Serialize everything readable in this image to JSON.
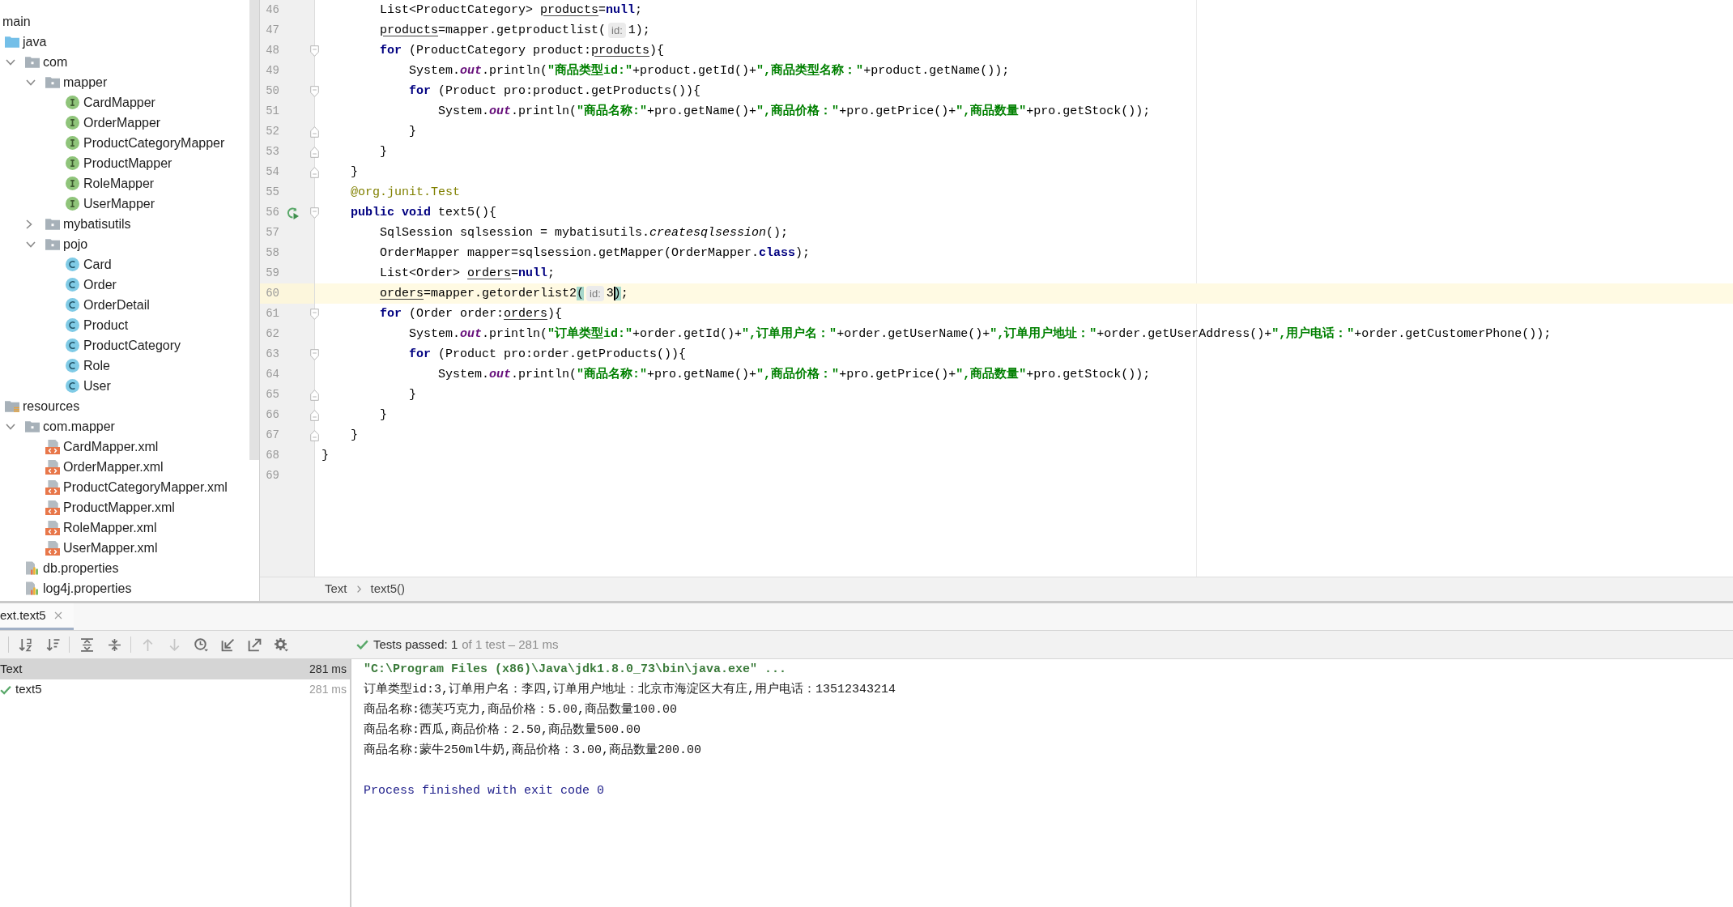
{
  "project_tree": {
    "items": [
      {
        "label": "main",
        "children": [
          {
            "label": "java",
            "kind": "source_folder",
            "children": [
              {
                "label": "com",
                "kind": "package",
                "expanded": true,
                "children": [
                  {
                    "label": "mapper",
                    "kind": "package",
                    "expanded": true,
                    "children": [
                      {
                        "label": "CardMapper",
                        "kind": "interface"
                      },
                      {
                        "label": "OrderMapper",
                        "kind": "interface"
                      },
                      {
                        "label": "ProductCategoryMapper",
                        "kind": "interface"
                      },
                      {
                        "label": "ProductMapper",
                        "kind": "interface"
                      },
                      {
                        "label": "RoleMapper",
                        "kind": "interface"
                      },
                      {
                        "label": "UserMapper",
                        "kind": "interface"
                      }
                    ]
                  },
                  {
                    "label": "mybatisutils",
                    "kind": "package",
                    "expanded": false
                  },
                  {
                    "label": "pojo",
                    "kind": "package",
                    "expanded": true,
                    "children": [
                      {
                        "label": "Card",
                        "kind": "class"
                      },
                      {
                        "label": "Order",
                        "kind": "class"
                      },
                      {
                        "label": "OrderDetail",
                        "kind": "class"
                      },
                      {
                        "label": "Product",
                        "kind": "class"
                      },
                      {
                        "label": "ProductCategory",
                        "kind": "class"
                      },
                      {
                        "label": "Role",
                        "kind": "class"
                      },
                      {
                        "label": "User",
                        "kind": "class"
                      }
                    ]
                  }
                ]
              }
            ]
          },
          {
            "label": "resources",
            "kind": "resources_folder",
            "children": [
              {
                "label": "com.mapper",
                "kind": "package",
                "expanded": true,
                "children": [
                  {
                    "label": "CardMapper.xml",
                    "kind": "xml"
                  },
                  {
                    "label": "OrderMapper.xml",
                    "kind": "xml"
                  },
                  {
                    "label": "ProductCategoryMapper.xml",
                    "kind": "xml"
                  },
                  {
                    "label": "ProductMapper.xml",
                    "kind": "xml"
                  },
                  {
                    "label": "RoleMapper.xml",
                    "kind": "xml"
                  },
                  {
                    "label": "UserMapper.xml",
                    "kind": "xml"
                  }
                ]
              },
              {
                "label": "db.properties",
                "kind": "properties"
              },
              {
                "label": "log4j.properties",
                "kind": "properties"
              }
            ]
          }
        ]
      }
    ]
  },
  "editor": {
    "lines": [
      {
        "number": "46",
        "current": false,
        "run": false,
        "tokens": [
          {
            "kind": "plain",
            "text": "        List<ProductCategory> "
          },
          {
            "kind": "local",
            "text": "products"
          },
          {
            "kind": "plain",
            "text": "="
          },
          {
            "kind": "keyword",
            "text": "null"
          },
          {
            "kind": "plain",
            "text": ";"
          }
        ]
      },
      {
        "number": "47",
        "current": false,
        "run": false,
        "tokens": [
          {
            "kind": "local",
            "text": "        products"
          },
          {
            "kind": "plain",
            "text": "=mapper.getproductlist("
          },
          {
            "kind": "hint",
            "text": "id:"
          },
          {
            "kind": "plain",
            "text": "1);"
          }
        ]
      },
      {
        "number": "48",
        "current": false,
        "run": false,
        "fold": {
          "kind": "start"
        },
        "tokens": [
          {
            "kind": "keyword",
            "text": "        for"
          },
          {
            "kind": "plain",
            "text": " (ProductCategory product:"
          },
          {
            "kind": "local",
            "text": "products"
          },
          {
            "kind": "plain",
            "text": "){"
          }
        ]
      },
      {
        "number": "49",
        "current": false,
        "run": false,
        "tokens": [
          {
            "kind": "plain",
            "text": "            System."
          },
          {
            "kind": "field",
            "text": "out"
          },
          {
            "kind": "plain",
            "text": ".println("
          },
          {
            "kind": "string",
            "text": "\"商品类型id:\""
          },
          {
            "kind": "plain",
            "text": "+product.getId()+"
          },
          {
            "kind": "string",
            "text": "\",商品类型名称：\""
          },
          {
            "kind": "plain",
            "text": "+product.getName());"
          }
        ]
      },
      {
        "number": "50",
        "current": false,
        "run": false,
        "fold": {
          "kind": "start"
        },
        "tokens": [
          {
            "kind": "keyword",
            "text": "            for"
          },
          {
            "kind": "plain",
            "text": " (Product pro:product.getProducts()){"
          }
        ]
      },
      {
        "number": "51",
        "current": false,
        "run": false,
        "tokens": [
          {
            "kind": "plain",
            "text": "                System."
          },
          {
            "kind": "field",
            "text": "out"
          },
          {
            "kind": "plain",
            "text": ".println("
          },
          {
            "kind": "string",
            "text": "\"商品名称:\""
          },
          {
            "kind": "plain",
            "text": "+pro.getName()+"
          },
          {
            "kind": "string",
            "text": "\",商品价格：\""
          },
          {
            "kind": "plain",
            "text": "+pro.getPrice()+"
          },
          {
            "kind": "string",
            "text": "\",商品数量\""
          },
          {
            "kind": "plain",
            "text": "+pro.getStock());"
          }
        ]
      },
      {
        "number": "52",
        "current": false,
        "run": false,
        "fold": {
          "kind": "end"
        },
        "tokens": [
          {
            "kind": "plain",
            "text": "            }"
          }
        ]
      },
      {
        "number": "53",
        "current": false,
        "run": false,
        "fold": {
          "kind": "end"
        },
        "tokens": [
          {
            "kind": "plain",
            "text": "        }"
          }
        ]
      },
      {
        "number": "54",
        "current": false,
        "run": false,
        "fold": {
          "kind": "end"
        },
        "tokens": [
          {
            "kind": "plain",
            "text": "    }"
          }
        ]
      },
      {
        "number": "55",
        "current": false,
        "run": false,
        "tokens": [
          {
            "kind": "annotation",
            "text": "    @org.junit.Test"
          }
        ]
      },
      {
        "number": "56",
        "current": false,
        "run": true,
        "fold": {
          "kind": "start"
        },
        "tokens": [
          {
            "kind": "keyword",
            "text": "    public void"
          },
          {
            "kind": "plain",
            "text": " text5(){"
          }
        ]
      },
      {
        "number": "57",
        "current": false,
        "run": false,
        "tokens": [
          {
            "kind": "plain",
            "text": "        SqlSession sqlsession = mybatisutils."
          },
          {
            "kind": "static",
            "text": "createsqlsession"
          },
          {
            "kind": "plain",
            "text": "();"
          }
        ]
      },
      {
        "number": "58",
        "current": false,
        "run": false,
        "tokens": [
          {
            "kind": "plain",
            "text": "        OrderMapper mapper=sqlsession.getMapper(OrderMapper."
          },
          {
            "kind": "keyword",
            "text": "class"
          },
          {
            "kind": "plain",
            "text": ");"
          }
        ]
      },
      {
        "number": "59",
        "current": false,
        "run": false,
        "tokens": [
          {
            "kind": "plain",
            "text": "        List<Order> "
          },
          {
            "kind": "local",
            "text": "orders"
          },
          {
            "kind": "plain",
            "text": "="
          },
          {
            "kind": "keyword",
            "text": "null"
          },
          {
            "kind": "plain",
            "text": ";"
          }
        ]
      },
      {
        "number": "60",
        "current": true,
        "run": false,
        "tokens": [
          {
            "kind": "local",
            "text": "        orders"
          },
          {
            "kind": "plain",
            "text": "=mapper.getorderlist2"
          },
          {
            "kind": "match",
            "text": "(",
            "caret": false
          },
          {
            "kind": "hint",
            "text": "id:"
          },
          {
            "kind": "plain",
            "text": "3"
          },
          {
            "kind": "match",
            "text": ")",
            "caret": true
          },
          {
            "kind": "plain",
            "text": ";"
          }
        ]
      },
      {
        "number": "61",
        "current": false,
        "run": false,
        "fold": {
          "kind": "start"
        },
        "tokens": [
          {
            "kind": "keyword",
            "text": "        for"
          },
          {
            "kind": "plain",
            "text": " (Order order:"
          },
          {
            "kind": "local",
            "text": "orders"
          },
          {
            "kind": "plain",
            "text": "){"
          }
        ]
      },
      {
        "number": "62",
        "current": false,
        "run": false,
        "tokens": [
          {
            "kind": "plain",
            "text": "            System."
          },
          {
            "kind": "field",
            "text": "out"
          },
          {
            "kind": "plain",
            "text": ".println("
          },
          {
            "kind": "string",
            "text": "\"订单类型id:\""
          },
          {
            "kind": "plain",
            "text": "+order.getId()+"
          },
          {
            "kind": "string",
            "text": "\",订单用户名：\""
          },
          {
            "kind": "plain",
            "text": "+order.getUserName()+"
          },
          {
            "kind": "string",
            "text": "\",订单用户地址：\""
          },
          {
            "kind": "plain",
            "text": "+order.getUserAddress()+"
          },
          {
            "kind": "string",
            "text": "\",用户电话：\""
          },
          {
            "kind": "plain",
            "text": "+order.getCustomerPhone());"
          }
        ]
      },
      {
        "number": "63",
        "current": false,
        "run": false,
        "fold": {
          "kind": "start"
        },
        "tokens": [
          {
            "kind": "keyword",
            "text": "            for"
          },
          {
            "kind": "plain",
            "text": " (Product pro:order.getProducts()){"
          }
        ]
      },
      {
        "number": "64",
        "current": false,
        "run": false,
        "tokens": [
          {
            "kind": "plain",
            "text": "                System."
          },
          {
            "kind": "field",
            "text": "out"
          },
          {
            "kind": "plain",
            "text": ".println("
          },
          {
            "kind": "string",
            "text": "\"商品名称:\""
          },
          {
            "kind": "plain",
            "text": "+pro.getName()+"
          },
          {
            "kind": "string",
            "text": "\",商品价格：\""
          },
          {
            "kind": "plain",
            "text": "+pro.getPrice()+"
          },
          {
            "kind": "string",
            "text": "\",商品数量\""
          },
          {
            "kind": "plain",
            "text": "+pro.getStock());"
          }
        ]
      },
      {
        "number": "65",
        "current": false,
        "run": false,
        "fold": {
          "kind": "end"
        },
        "tokens": [
          {
            "kind": "plain",
            "text": "            }"
          }
        ]
      },
      {
        "number": "66",
        "current": false,
        "run": false,
        "fold": {
          "kind": "end"
        },
        "tokens": [
          {
            "kind": "plain",
            "text": "        }"
          }
        ]
      },
      {
        "number": "67",
        "current": false,
        "run": false,
        "fold": {
          "kind": "end"
        },
        "tokens": [
          {
            "kind": "plain",
            "text": "    }"
          }
        ]
      },
      {
        "number": "68",
        "current": false,
        "run": false,
        "tokens": [
          {
            "kind": "plain",
            "text": "}"
          }
        ]
      },
      {
        "number": "69",
        "current": false,
        "run": false
      }
    ],
    "breadcrumbs": [
      "Text",
      "text5()"
    ]
  },
  "run_panel": {
    "tabs": [
      {
        "label": "ext.text5",
        "selected": true
      }
    ],
    "toolbar": [
      [
        {
          "disabled": false
        },
        {
          "disabled": false
        }
      ],
      [
        {
          "disabled": false
        },
        {
          "disabled": false
        }
      ],
      [
        {
          "disabled": true
        },
        {
          "disabled": true
        },
        {
          "disabled": false
        },
        {
          "disabled": false
        },
        {
          "disabled": false
        },
        {
          "disabled": false
        }
      ]
    ],
    "status": {
      "passed": true,
      "summary": "Tests passed: 1",
      "detail": "of 1 test – 281 ms"
    },
    "tests": [
      {
        "label": "Text",
        "duration": "281 ms",
        "selected": true,
        "children": [
          {
            "label": "text5",
            "passed": true,
            "duration": "281 ms",
            "selected": false
          }
        ]
      }
    ],
    "console": [
      {
        "kind": "command",
        "text": "\"C:\\Program Files (x86)\\Java\\jdk1.8.0_73\\bin\\java.exe\" ..."
      },
      {
        "kind": "output",
        "text": "订单类型id:3,订单用户名：李四,订单用户地址：北京市海淀区大有庄,用户电话：13512343214"
      },
      {
        "kind": "output",
        "text": "商品名称:德芙巧克力,商品价格：5.00,商品数量100.00"
      },
      {
        "kind": "output",
        "text": "商品名称:西瓜,商品价格：2.50,商品数量500.00"
      },
      {
        "kind": "output",
        "text": "商品名称:蒙牛250ml牛奶,商品价格：3.00,商品数量200.00"
      },
      {
        "kind": "exit",
        "text": "Process finished with exit code 0"
      }
    ]
  }
}
